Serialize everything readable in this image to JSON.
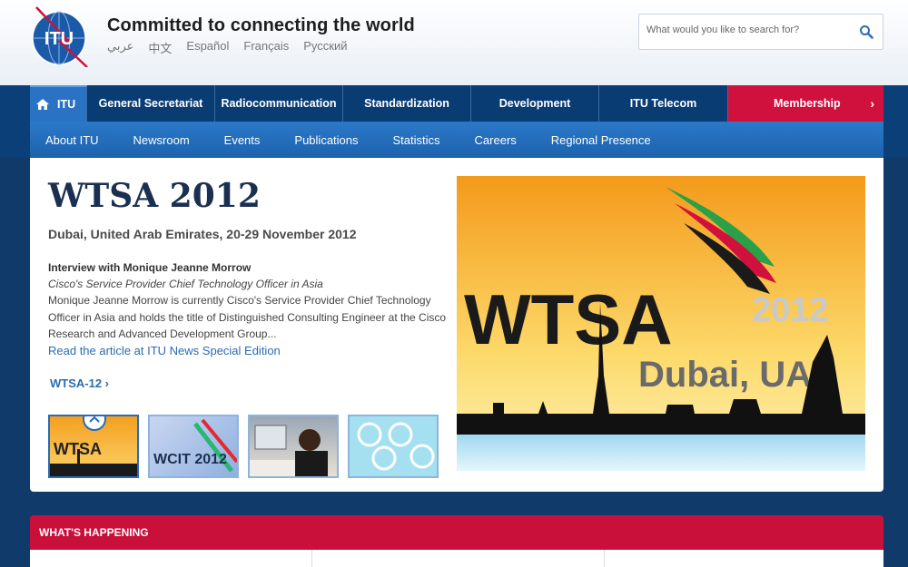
{
  "header": {
    "logo_text": "ITU",
    "tagline": "Committed to connecting the world",
    "languages": [
      "عربي",
      "中文",
      "Español",
      "Français",
      "Русский"
    ],
    "search_placeholder": "What would you like to search for?"
  },
  "nav": {
    "items": [
      "ITU",
      "General Secretariat",
      "Radiocommunication",
      "Standardization",
      "Development",
      "ITU Telecom",
      "Membership"
    ],
    "subitems": [
      "About ITU",
      "Newsroom",
      "Events",
      "Publications",
      "Statistics",
      "Careers",
      "Regional Presence"
    ]
  },
  "feature": {
    "title": "WTSA 2012",
    "subtitle": "Dubai, United Arab Emirates, 20-29 November 2012",
    "interview_title": "Interview with Monique Jeanne Morrow",
    "interview_role": "Cisco's Service Provider Chief Technology Officer in Asia",
    "interview_body": "Monique Jeanne Morrow is currently Cisco's Service Provider Chief Technology Officer in Asia and holds the title of Distinguished Consulting Engineer at the Cisco Research and Advanced Development Group...",
    "read_link": "Read the article at ITU News Special Edition",
    "more_link": "WTSA-12 ›",
    "hero_text_main": "WTSA",
    "hero_text_year": "2012",
    "hero_text_place": "Dubai, UAE",
    "thumb_labels": [
      "WTSA",
      "WCIT 2012"
    ]
  },
  "happening": {
    "label": "WHAT'S HAPPENING"
  },
  "colors": {
    "nav_bg": "#0a3c74",
    "subnav_bg": "#1d62ad",
    "membership_red": "#d1113d",
    "link_blue": "#2a6bb5"
  }
}
